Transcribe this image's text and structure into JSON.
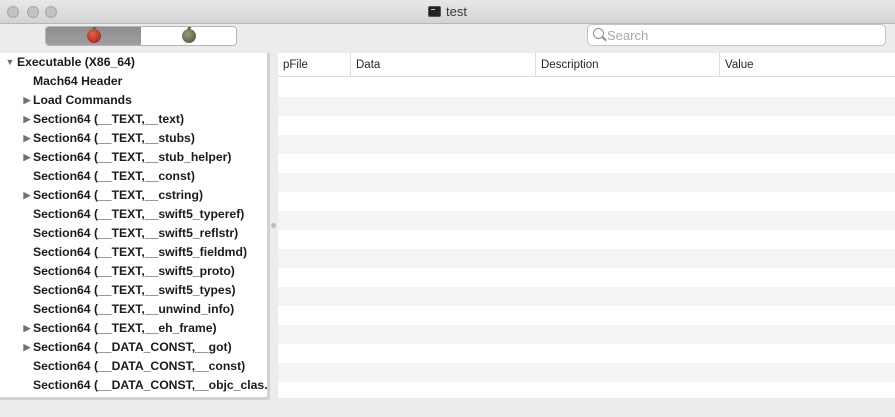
{
  "window": {
    "title": "test"
  },
  "toolbar": {
    "segments": [
      {
        "icon": "red-apple-icon",
        "active": true
      },
      {
        "icon": "gray-apple-icon",
        "active": false
      }
    ]
  },
  "search": {
    "placeholder": "Search",
    "value": ""
  },
  "outline": {
    "items": [
      {
        "label": "Executable  (X86_64)",
        "disclosure": "expanded",
        "level": 0
      },
      {
        "label": "Mach64 Header",
        "disclosure": "none",
        "level": 1
      },
      {
        "label": "Load Commands",
        "disclosure": "collapsed",
        "level": 1
      },
      {
        "label": "Section64 (__TEXT,__text)",
        "disclosure": "collapsed",
        "level": 1
      },
      {
        "label": "Section64 (__TEXT,__stubs)",
        "disclosure": "collapsed",
        "level": 1
      },
      {
        "label": "Section64 (__TEXT,__stub_helper)",
        "disclosure": "collapsed",
        "level": 1
      },
      {
        "label": "Section64 (__TEXT,__const)",
        "disclosure": "none",
        "level": 1
      },
      {
        "label": "Section64 (__TEXT,__cstring)",
        "disclosure": "collapsed",
        "level": 1
      },
      {
        "label": "Section64 (__TEXT,__swift5_typeref)",
        "disclosure": "none",
        "level": 1
      },
      {
        "label": "Section64 (__TEXT,__swift5_reflstr)",
        "disclosure": "none",
        "level": 1
      },
      {
        "label": "Section64 (__TEXT,__swift5_fieldmd)",
        "disclosure": "none",
        "level": 1
      },
      {
        "label": "Section64 (__TEXT,__swift5_proto)",
        "disclosure": "none",
        "level": 1
      },
      {
        "label": "Section64 (__TEXT,__swift5_types)",
        "disclosure": "none",
        "level": 1
      },
      {
        "label": "Section64 (__TEXT,__unwind_info)",
        "disclosure": "none",
        "level": 1
      },
      {
        "label": "Section64 (__TEXT,__eh_frame)",
        "disclosure": "collapsed",
        "level": 1
      },
      {
        "label": "Section64 (__DATA_CONST,__got)",
        "disclosure": "collapsed",
        "level": 1
      },
      {
        "label": "Section64 (__DATA_CONST,__const)",
        "disclosure": "none",
        "level": 1
      },
      {
        "label": "Section64 (__DATA_CONST,__objc_clas.",
        "disclosure": "none",
        "level": 1
      }
    ]
  },
  "table": {
    "columns": [
      "pFile",
      "Data",
      "Description",
      "Value"
    ],
    "rows": []
  }
}
